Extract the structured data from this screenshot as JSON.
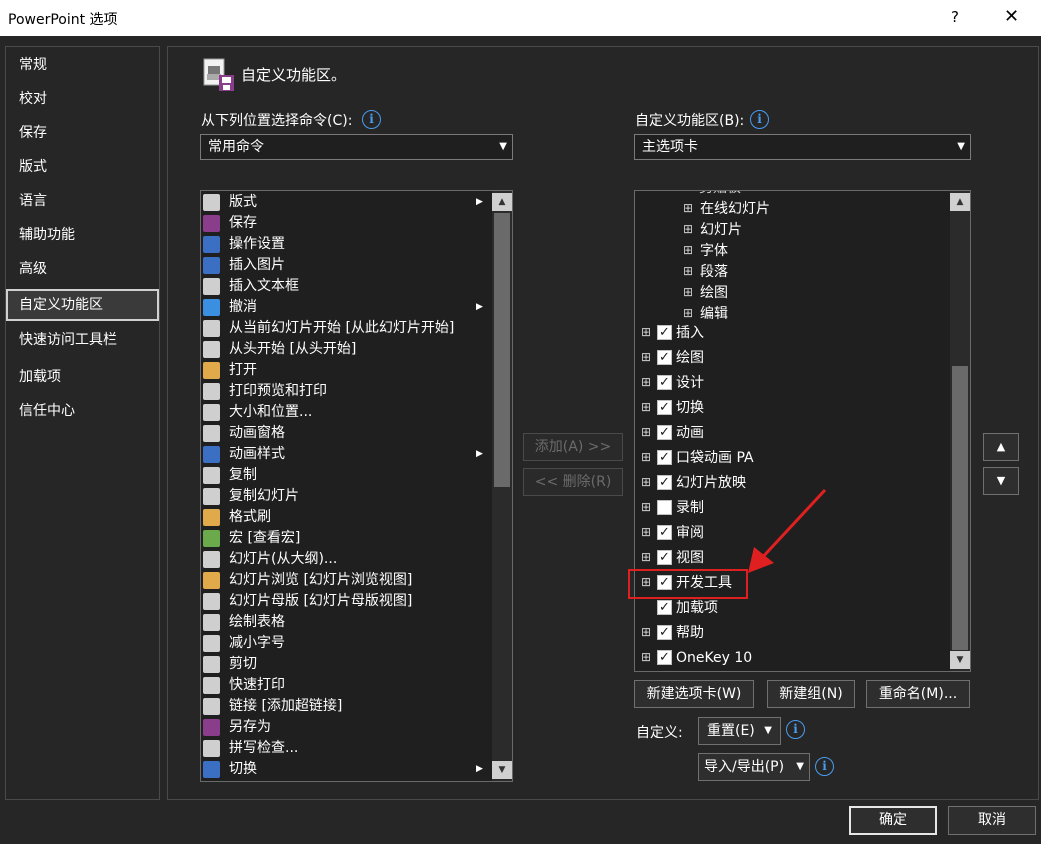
{
  "window": {
    "title": "PowerPoint 选项",
    "help": "?",
    "close": "✕"
  },
  "nav": {
    "items": [
      "常规",
      "校对",
      "保存",
      "版式",
      "语言",
      "辅助功能",
      "高级",
      "自定义功能区",
      "快速访问工具栏",
      "加载项",
      "信任中心"
    ],
    "selected": "自定义功能区"
  },
  "header": {
    "title": "自定义功能区。"
  },
  "left": {
    "choose_label": "从下列位置选择命令(C):",
    "choose_value": "常用命令",
    "commands": [
      {
        "label": "版式",
        "icon": "layout-icon",
        "submenu": true
      },
      {
        "label": "保存",
        "icon": "save-icon",
        "submenu": false
      },
      {
        "label": "操作设置",
        "icon": "action-star-icon",
        "submenu": false
      },
      {
        "label": "插入图片",
        "icon": "insert-picture-icon",
        "submenu": false
      },
      {
        "label": "插入文本框",
        "icon": "textbox-icon",
        "submenu": false
      },
      {
        "label": "撤消",
        "icon": "undo-icon",
        "submenu": true
      },
      {
        "label": "从当前幻灯片开始 [从此幻灯片开始]",
        "icon": "present-current-icon",
        "submenu": false
      },
      {
        "label": "从头开始 [从头开始]",
        "icon": "present-beginning-icon",
        "submenu": false
      },
      {
        "label": "打开",
        "icon": "open-folder-icon",
        "submenu": false
      },
      {
        "label": "打印预览和打印",
        "icon": "print-preview-icon",
        "submenu": false
      },
      {
        "label": "大小和位置...",
        "icon": "size-position-icon",
        "submenu": false
      },
      {
        "label": "动画窗格",
        "icon": "animation-pane-icon",
        "submenu": false
      },
      {
        "label": "动画样式",
        "icon": "animation-star-icon",
        "submenu": true
      },
      {
        "label": "复制",
        "icon": "copy-icon",
        "submenu": false
      },
      {
        "label": "复制幻灯片",
        "icon": "duplicate-slide-icon",
        "submenu": false
      },
      {
        "label": "格式刷",
        "icon": "format-painter-icon",
        "submenu": false
      },
      {
        "label": "宏 [查看宏]",
        "icon": "macro-play-icon",
        "submenu": false
      },
      {
        "label": "幻灯片(从大纲)...",
        "icon": "slides-outline-icon",
        "submenu": false
      },
      {
        "label": "幻灯片浏览 [幻灯片浏览视图]",
        "icon": "slide-sorter-icon",
        "submenu": false
      },
      {
        "label": "幻灯片母版 [幻灯片母版视图]",
        "icon": "slide-master-icon",
        "submenu": false
      },
      {
        "label": "绘制表格",
        "icon": "draw-table-icon",
        "submenu": false
      },
      {
        "label": "减小字号",
        "icon": "decrease-font-icon",
        "submenu": false
      },
      {
        "label": "剪切",
        "icon": "scissors-icon",
        "submenu": false
      },
      {
        "label": "快速打印",
        "icon": "quick-print-icon",
        "submenu": false
      },
      {
        "label": "链接 [添加超链接]",
        "icon": "link-icon",
        "submenu": false
      },
      {
        "label": "另存为",
        "icon": "save-as-icon",
        "submenu": false
      },
      {
        "label": "拼写检查...",
        "icon": "spelling-icon",
        "submenu": false
      },
      {
        "label": "切换",
        "icon": "transition-icon",
        "submenu": true
      }
    ]
  },
  "middle": {
    "add": "添加(A) >>",
    "remove": "<< 删除(R)"
  },
  "right": {
    "custom_label": "自定义功能区(B):",
    "custom_value": "主选项卡",
    "partial_top": "剪贴板",
    "groups": [
      "在线幻灯片",
      "幻灯片",
      "字体",
      "段落",
      "绘图",
      "编辑"
    ],
    "tabs": [
      {
        "label": "插入",
        "checked": true,
        "expand": true
      },
      {
        "label": "绘图",
        "checked": true,
        "expand": true
      },
      {
        "label": "设计",
        "checked": true,
        "expand": true
      },
      {
        "label": "切换",
        "checked": true,
        "expand": true
      },
      {
        "label": "动画",
        "checked": true,
        "expand": true
      },
      {
        "label": "口袋动画 PA",
        "checked": true,
        "expand": true
      },
      {
        "label": "幻灯片放映",
        "checked": true,
        "expand": true
      },
      {
        "label": "录制",
        "checked": false,
        "expand": true
      },
      {
        "label": "审阅",
        "checked": true,
        "expand": true
      },
      {
        "label": "视图",
        "checked": true,
        "expand": true
      },
      {
        "label": "开发工具",
        "checked": true,
        "expand": true
      },
      {
        "label": "加载项",
        "checked": true,
        "expand": false
      },
      {
        "label": "帮助",
        "checked": true,
        "expand": true
      },
      {
        "label": "OneKey 10",
        "checked": true,
        "expand": true
      }
    ],
    "new_tab": "新建选项卡(W)",
    "new_group": "新建组(N)",
    "rename": "重命名(M)...",
    "customize_label": "自定义:",
    "reset": "重置(E)",
    "import_export": "导入/导出(P)"
  },
  "footer": {
    "ok": "确定",
    "cancel": "取消"
  },
  "colors": {
    "accent_info": "#4a9cf0",
    "annotation_red": "#e02020",
    "background": "#262626"
  }
}
